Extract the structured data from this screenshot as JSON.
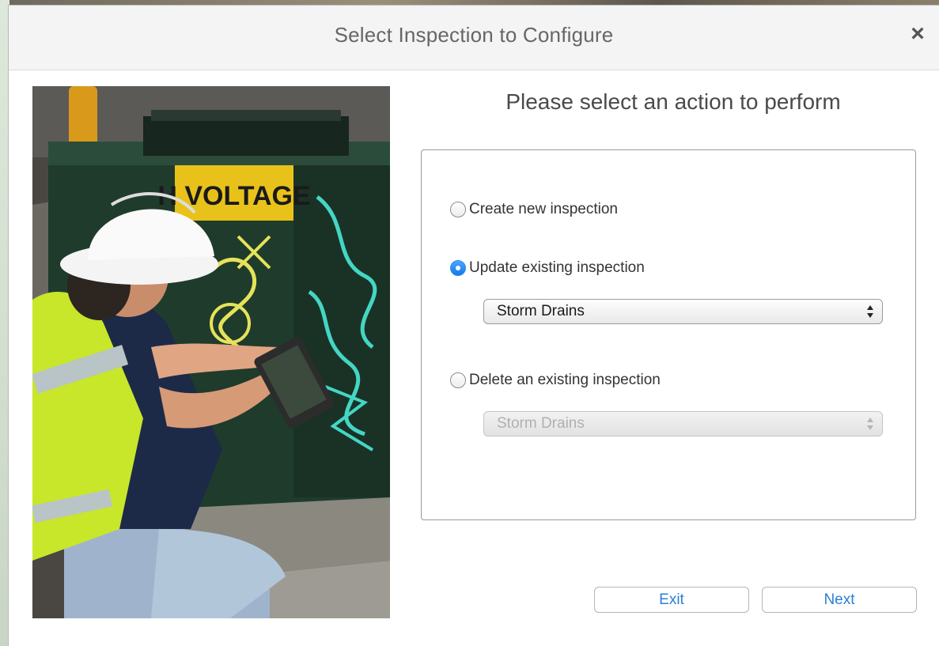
{
  "dialog": {
    "title": "Select Inspection to Configure",
    "close_label": "×"
  },
  "panel": {
    "heading": "Please select an action to perform"
  },
  "options": [
    {
      "label": "Create new inspection",
      "checked": false
    },
    {
      "label": "Update existing inspection",
      "checked": true
    },
    {
      "label": "Delete an existing inspection",
      "checked": false
    }
  ],
  "update_select": {
    "value": "Storm Drains",
    "enabled": true
  },
  "delete_select": {
    "value": "Storm Drains",
    "enabled": false
  },
  "buttons": {
    "exit_label": "Exit",
    "next_label": "Next"
  },
  "photo": {
    "sign_text": "H VOLTAGE"
  },
  "colors": {
    "accent": "#2a7fd4",
    "radio_selected": "#1778e8",
    "vest": "#c8e62a",
    "cabinet": "#1e3a2c"
  }
}
